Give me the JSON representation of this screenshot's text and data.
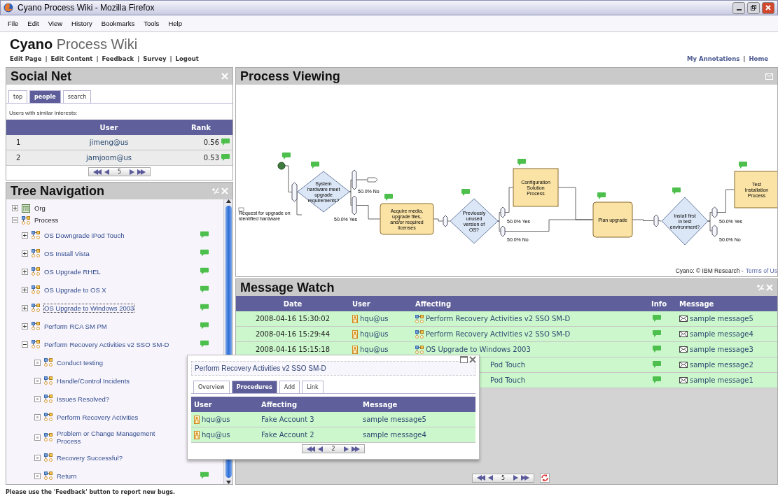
{
  "window": {
    "title": "Cyano Process Wiki - Mozilla Firefox"
  },
  "menu": [
    "File",
    "Edit",
    "View",
    "History",
    "Bookmarks",
    "Tools",
    "Help"
  ],
  "site": {
    "title_bold": "Cyano",
    "title_rest": "Process Wiki",
    "separator": "|",
    "nav": [
      "Edit Page",
      "Edit Content",
      "Feedback",
      "Survey",
      "Logout"
    ],
    "nav_right": [
      "My Annotations",
      "Home"
    ]
  },
  "social_net": {
    "title": "Social Net",
    "tabs": [
      {
        "label": "top",
        "selected": false
      },
      {
        "label": "people",
        "selected": true
      },
      {
        "label": "search",
        "selected": false
      }
    ],
    "caption": "Users with similar interests:",
    "columns": [
      "User",
      "Rank"
    ],
    "rows": [
      {
        "index": "1",
        "user": "jimeng@us",
        "rank": "0.56"
      },
      {
        "index": "2",
        "user": "jamjoom@us",
        "rank": "0.53"
      }
    ],
    "pager": {
      "page": "5"
    }
  },
  "tree_navigation": {
    "title": "Tree Navigation",
    "items": [
      {
        "label": "Org",
        "expanded": false,
        "comment": false
      },
      {
        "label": "Process",
        "expanded": true,
        "comment": false,
        "children": [
          {
            "label": "OS Downgrade iPod Touch",
            "expanded": false,
            "comment": true
          },
          {
            "label": "OS Install Vista",
            "expanded": false,
            "comment": true
          },
          {
            "label": "OS Upgrade RHEL",
            "expanded": false,
            "comment": true
          },
          {
            "label": "OS Upgrade to OS X",
            "expanded": false,
            "comment": true
          },
          {
            "label": "OS Upgrade to Windows 2003",
            "expanded": false,
            "comment": true,
            "focused": true
          },
          {
            "label": "Perform RCA SM PM",
            "expanded": false,
            "comment": true
          },
          {
            "label": "Perform Recovery Activities v2 SSO SM-D",
            "expanded": true,
            "comment": true,
            "children": [
              {
                "label": "Conduct testing"
              },
              {
                "label": "Handle/Control Incidents"
              },
              {
                "label": "Issues Resolved?"
              },
              {
                "label": "Perform Recovery Activities"
              },
              {
                "label": "Problem or Change Management Process"
              },
              {
                "label": "Recovery Successful?"
              },
              {
                "label": "Return",
                "comment": true
              }
            ]
          }
        ]
      }
    ]
  },
  "process_viewing": {
    "title": "Process Viewing",
    "credit": "Cyano: © IBM Research -",
    "credit_link": "Terms of Us",
    "diagram": {
      "nodes": [
        {
          "kind": "start",
          "comment": true
        },
        {
          "kind": "gateway",
          "comment": false
        },
        {
          "kind": "event",
          "label": "Request for upgrade on identified hardware",
          "comment": false
        },
        {
          "kind": "decision",
          "label": "System hardware meet upgrade requirements?",
          "comment": true
        },
        {
          "kind": "gateway",
          "comment": false
        },
        {
          "kind": "gateway",
          "comment": false
        },
        {
          "kind": "end",
          "comment": false
        },
        {
          "kind": "task",
          "label": "Acquire media, upgrade files, and/or required licenses",
          "comment": true
        },
        {
          "kind": "gateway",
          "comment": false
        },
        {
          "kind": "decision",
          "label": "Previously unused version of OS?",
          "comment": true
        },
        {
          "kind": "gateway",
          "comment": false
        },
        {
          "kind": "gateway",
          "comment": false
        },
        {
          "kind": "subprocess",
          "label": "Configuration Solution Process",
          "comment": true
        },
        {
          "kind": "task",
          "label": "Plan upgrade",
          "comment": true
        },
        {
          "kind": "gateway",
          "comment": false
        },
        {
          "kind": "decision",
          "label": "Install first in test environment?",
          "comment": true
        },
        {
          "kind": "gateway",
          "comment": false
        },
        {
          "kind": "gateway",
          "comment": false
        },
        {
          "kind": "subprocess",
          "label": "Test Installation Process",
          "comment": true
        }
      ],
      "branch_labels": [
        "50.0% No",
        "50.0% Yes",
        "50.0% Yes",
        "50.0% No",
        "50.0% Yes",
        "50.0% No"
      ]
    }
  },
  "message_watch": {
    "title": "Message Watch",
    "columns": [
      "Date",
      "User",
      "Affecting",
      "Info",
      "Message"
    ],
    "rows": [
      {
        "date": "2008-04-16 15:30:02",
        "user": "hqu@us",
        "affecting": "Perform Recovery Activities v2 SSO SM-D",
        "info": true,
        "message": "sample message5"
      },
      {
        "date": "2008-04-16 15:29:44",
        "user": "hqu@us",
        "affecting": "Perform Recovery Activities v2 SSO SM-D",
        "info": true,
        "message": "sample message4"
      },
      {
        "date": "2008-04-16 15:15:18",
        "user": "hqu@us",
        "affecting": "OS Upgrade to Windows 2003",
        "info": true,
        "message": "sample message3"
      },
      {
        "affecting": "Pod Touch",
        "clipped": true,
        "info": true,
        "message": "sample message2"
      },
      {
        "affecting": "Pod Touch",
        "clipped": true,
        "info": true,
        "message": "sample message1"
      }
    ],
    "pager": {
      "page": "5"
    }
  },
  "popup": {
    "title": "Perform Recovery Activities v2 SSO SM-D",
    "tabs": [
      {
        "label": "Overview",
        "selected": false
      },
      {
        "label": "Procedures",
        "selected": true
      },
      {
        "label": "Add",
        "selected": false
      },
      {
        "label": "Link",
        "selected": false
      }
    ],
    "columns": [
      "User",
      "Affecting",
      "Message"
    ],
    "rows": [
      {
        "user": "hqu@us",
        "affecting": "Fake Account 3",
        "message": "sample message5"
      },
      {
        "user": "hqu@us",
        "affecting": "Fake Account 2",
        "message": "sample message4"
      }
    ],
    "pager": {
      "page": "2"
    }
  },
  "footer": "Please use the 'Feedback' button to report new bugs."
}
